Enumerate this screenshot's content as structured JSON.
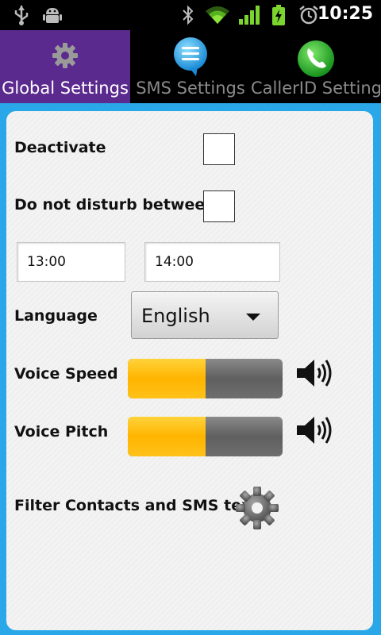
{
  "status_bar": {
    "time": "10:25",
    "icons": [
      "usb-icon",
      "android-debug-icon",
      "bluetooth-icon",
      "wifi-icon",
      "signal-icon",
      "battery-icon",
      "alarm-icon"
    ]
  },
  "tabs": [
    {
      "label": "Global Settings",
      "icon": "gear-icon",
      "active": true
    },
    {
      "label": "SMS Settings",
      "icon": "sms-bubble-icon",
      "active": false
    },
    {
      "label": "CallerID Settings",
      "icon": "phone-icon",
      "active": false
    }
  ],
  "settings": {
    "deactivate_label": "Deactivate",
    "deactivate_checked": false,
    "dnd_label": "Do not disturb between",
    "dnd_checked": false,
    "dnd_start": "13:00",
    "dnd_end": "14:00",
    "language_label": "Language",
    "language_value": "English",
    "voice_speed_label": "Voice Speed",
    "voice_speed_level": 0.5,
    "voice_pitch_label": "Voice Pitch",
    "voice_pitch_level": 0.5,
    "filter_label": "Filter Contacts and SMS text"
  },
  "colors": {
    "active_tab": "#5b2a8e",
    "accent_blue": "#29a7e8",
    "slider_fill": "#ffb400"
  }
}
